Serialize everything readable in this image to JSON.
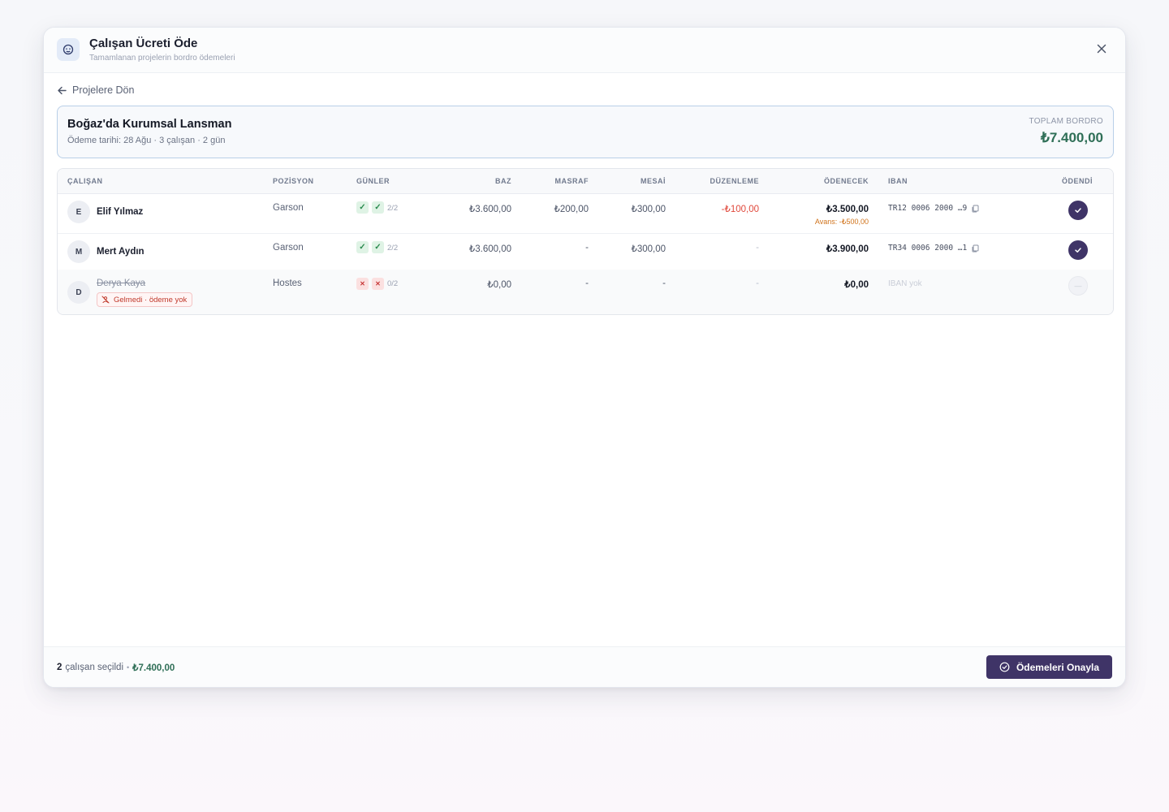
{
  "modal": {
    "title": "Çalışan Ücreti Öde",
    "subtitle": "Tamamlanan projelerin bordro ödemeleri",
    "back_label": "Projelere Dön"
  },
  "project": {
    "name": "Boğaz'da Kurumsal Lansman",
    "meta": "Ödeme tarihi: 28 Ağu · 3 çalışan · 2 gün",
    "total_label": "TOPLAM BORDRO",
    "total_value": "₺7.400,00"
  },
  "table": {
    "headers": {
      "employee": "ÇALIŞAN",
      "position": "POZİSYON",
      "days": "GÜNLER",
      "base": "BAZ",
      "expense": "MASRAF",
      "overtime": "MESAİ",
      "adjustment": "DÜZENLEME",
      "payable": "ÖDENECEK",
      "iban": "IBAN",
      "paid": "ÖDENDİ"
    },
    "rows": [
      {
        "initial": "E",
        "name": "Elif Yılmaz",
        "position": "Garson",
        "days_count": "2/2",
        "base": "₺3.600,00",
        "expense": "₺200,00",
        "overtime": "₺300,00",
        "adjustment": "-₺100,00",
        "payable": "₺3.500,00",
        "advance_note": "Avans: -₺500,00",
        "iban": "TR12 0006 2000 …9",
        "paid": true
      },
      {
        "initial": "M",
        "name": "Mert Aydın",
        "position": "Garson",
        "days_count": "2/2",
        "base": "₺3.600,00",
        "expense": "-",
        "overtime": "₺300,00",
        "adjustment": "-",
        "payable": "₺3.900,00",
        "iban": "TR34 0006 2000 …1",
        "paid": true
      },
      {
        "initial": "D",
        "name": "Derya Kaya",
        "absent_badge": "Gelmedi · ödeme yok",
        "position": "Hostes",
        "days_count": "0/2",
        "base": "₺0,00",
        "expense": "-",
        "overtime": "-",
        "adjustment": "-",
        "payable": "₺0,00",
        "iban": "IBAN yok",
        "paid_placeholder": "—",
        "paid": false
      }
    ]
  },
  "footer": {
    "selected_count": "2",
    "selected_label": "çalışan seçildi",
    "separator": "•",
    "selected_total": "₺7.400,00",
    "confirm_label": "Ödemeleri Onayla"
  },
  "colors": {
    "accent": "#3f3467",
    "positive": "#2f6f57",
    "negative": "#e0483b",
    "warning": "#d0731b"
  },
  "icons": {
    "header": "user-payment-icon",
    "close": "close-icon",
    "back": "arrow-left-icon",
    "copy": "copy-icon",
    "check": "check-icon",
    "absent": "user-x-icon",
    "confirm": "check-circle-icon"
  }
}
